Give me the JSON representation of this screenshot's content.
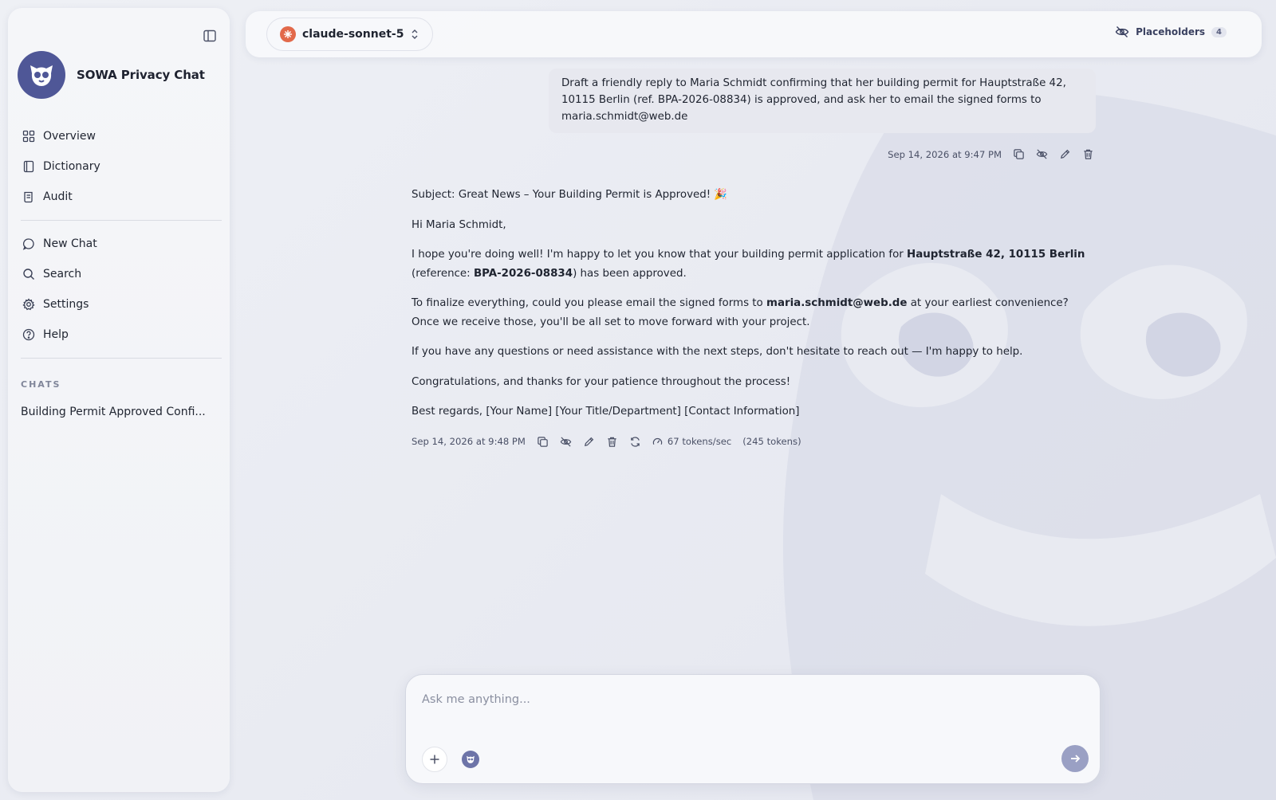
{
  "app": {
    "title": "SOWA Privacy Chat"
  },
  "nav": {
    "primary": [
      {
        "label": "Overview",
        "icon": "grid-icon"
      },
      {
        "label": "Dictionary",
        "icon": "book-icon"
      },
      {
        "label": "Audit",
        "icon": "scroll-icon"
      }
    ],
    "secondary": [
      {
        "label": "New Chat",
        "icon": "chat-bubble-icon"
      },
      {
        "label": "Search",
        "icon": "search-icon"
      },
      {
        "label": "Settings",
        "icon": "gear-icon"
      },
      {
        "label": "Help",
        "icon": "help-circle-icon"
      }
    ]
  },
  "chats": {
    "heading": "CHATS",
    "items": [
      "Building Permit Approved Confi..."
    ]
  },
  "topbar": {
    "model": "claude-sonnet-5",
    "placeholders_label": "Placeholders",
    "placeholders_count": "4"
  },
  "user_message": {
    "text": "Draft a friendly reply to Maria Schmidt confirming that her building permit for Hauptstraße 42, 10115 Berlin (ref. BPA-2026-08834) is approved, and ask her to email the signed forms to maria.schmidt@web.de",
    "timestamp": "Sep 14, 2026 at 9:47 PM"
  },
  "assistant_message": {
    "subject": "Subject: Great News – Your Building Permit is Approved! 🎉",
    "greeting": "Hi Maria Schmidt,",
    "p1_a": "I hope you're doing well! I'm happy to let you know that your building permit application for ",
    "p1_address": "Hauptstraße 42, 10115 Berlin",
    "p1_b": " (reference: ",
    "p1_ref": "BPA-2026-08834",
    "p1_c": ") has been approved.",
    "p2_a": "To finalize everything, could you please email the signed forms to ",
    "p2_email": "maria.schmidt@web.de",
    "p2_b": " at your earliest convenience? Once we receive those, you'll be all set to move forward with your project.",
    "p3": "If you have any questions or need assistance with the next steps, don't hesitate to reach out — I'm happy to help.",
    "p4": "Congratulations, and thanks for your patience throughout the process!",
    "sign": "Best regards, [Your Name] [Your Title/Department] [Contact Information]",
    "timestamp": "Sep 14, 2026 at 9:48 PM",
    "speed": "67 tokens/sec",
    "tokens": "(245 tokens)"
  },
  "composer": {
    "placeholder": "Ask me anything..."
  },
  "colors": {
    "accent": "#4f5797",
    "model_dot": "#e2694a",
    "send": "#9aa0c4"
  }
}
